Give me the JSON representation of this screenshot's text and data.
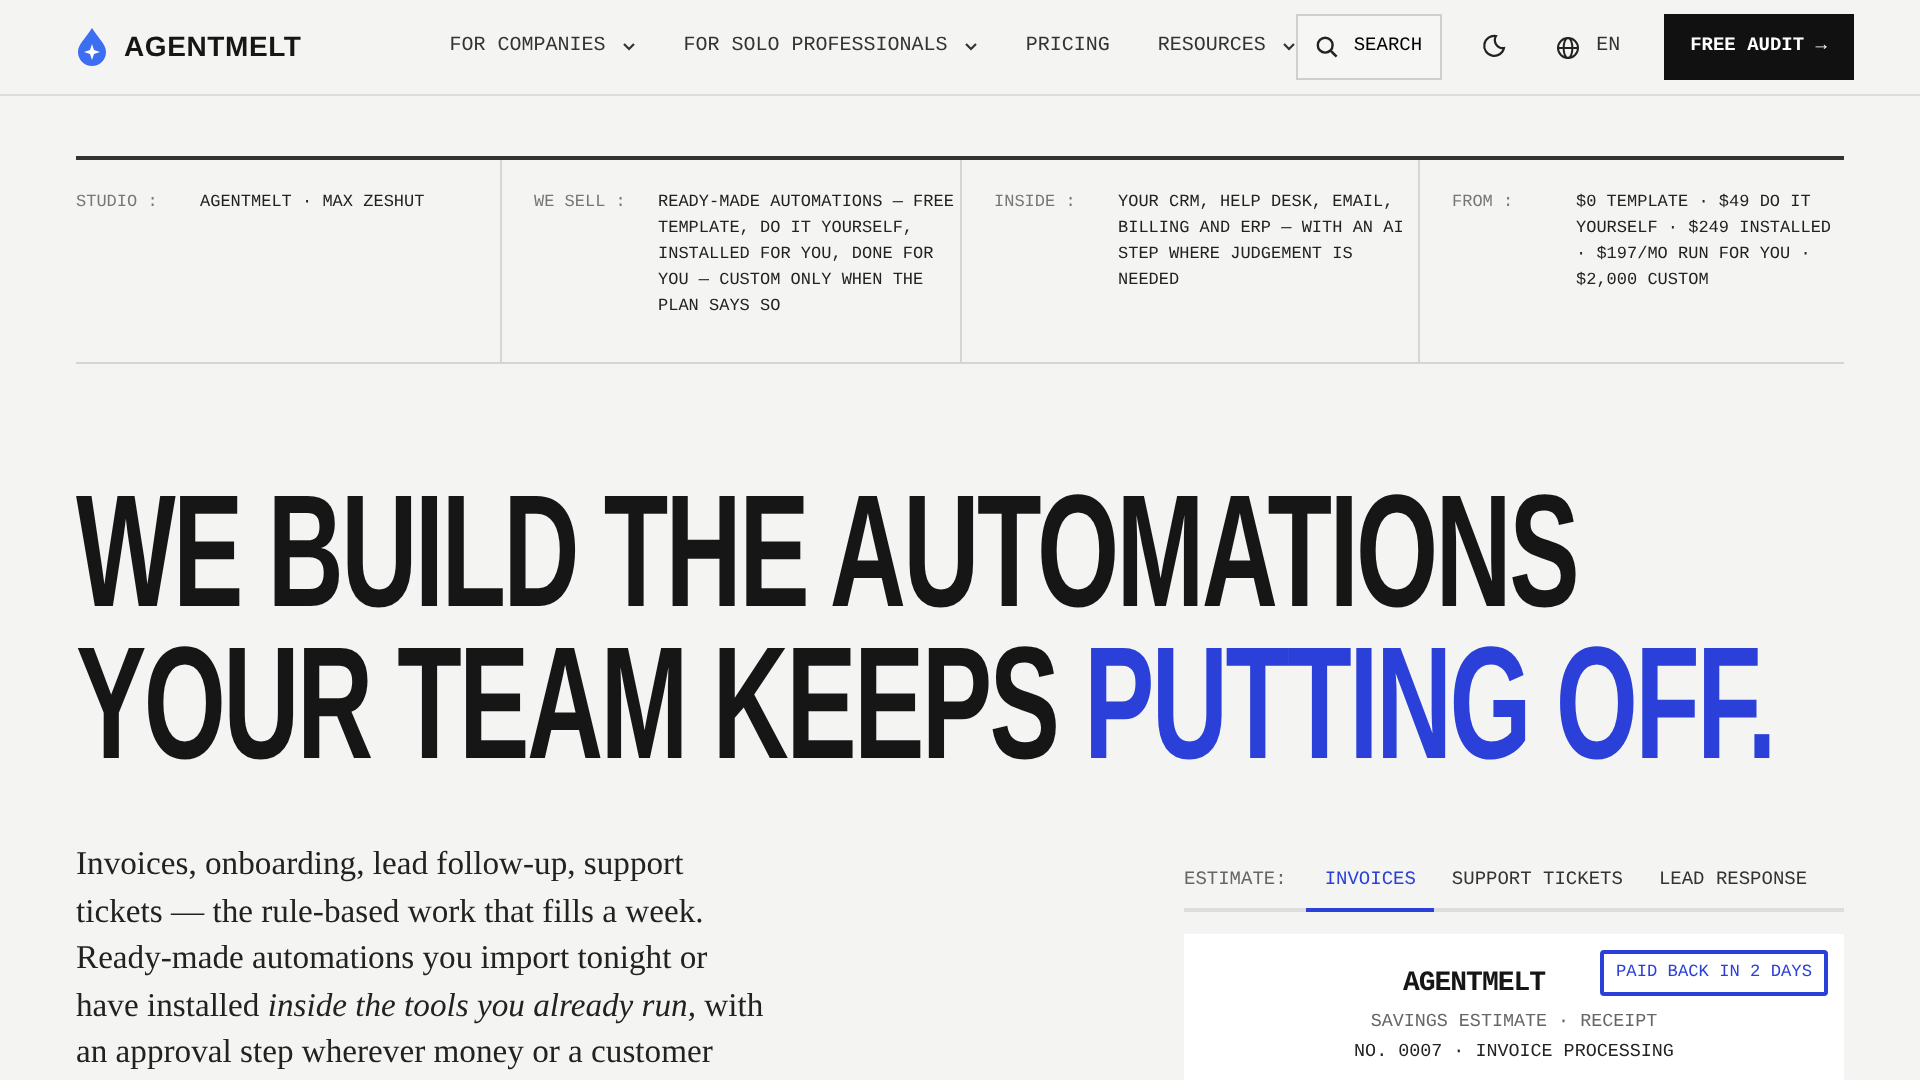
{
  "nav": {
    "brand": "AGENTMELT",
    "links": [
      {
        "label": "FOR COMPANIES",
        "dropdown": true
      },
      {
        "label": "FOR SOLO PROFESSIONALS",
        "dropdown": true
      },
      {
        "label": "PRICING",
        "dropdown": false
      },
      {
        "label": "RESOURCES",
        "dropdown": true
      }
    ],
    "search": "SEARCH",
    "language": "EN",
    "cta": "FREE AUDIT →"
  },
  "facts": [
    {
      "label": "STUDIO :",
      "value": "AGENTMELT · MAX ZESHUT"
    },
    {
      "label": "WE SELL :",
      "value": "READY-MADE AUTOMATIONS — FREE TEMPLATE, DO IT YOURSELF, INSTALLED FOR YOU, DONE FOR YOU — CUSTOM ONLY WHEN THE PLAN SAYS SO"
    },
    {
      "label": "INSIDE :",
      "value": "YOUR CRM, HELP DESK, EMAIL, BILLING AND ERP — WITH AN AI STEP WHERE JUDGEMENT IS NEEDED"
    },
    {
      "label": "FROM :",
      "value": "$0 TEMPLATE · $49 DO IT YOURSELF · $249 INSTALLED · $197/MO RUN FOR YOU · $2,000 CUSTOM"
    }
  ],
  "headline": {
    "line_1": "WE BUILD THE AUTOMATIONS",
    "line_2": "YOUR TEAM KEEPS",
    "line_2_accent": "PUTTING OFF."
  },
  "intro": "Invoices, onboarding, lead follow-up, support tickets — the rule-based work that fills a week. Ready-made automations you import tonight or have installed *inside the tools you already run,* with an approval step wherever money or a customer",
  "estimate": {
    "label": "ESTIMATE:",
    "tabs": [
      {
        "label": "INVOICES",
        "selected": true
      },
      {
        "label": "SUPPORT TICKETS",
        "selected": false
      },
      {
        "label": "LEAD RESPONSE",
        "selected": false
      }
    ],
    "receipt": {
      "brand": "AGENTMELT",
      "badge": "PAID BACK IN 2 DAYS",
      "subtitle": "SAVINGS ESTIMATE · RECEIPT",
      "number": "NO. 0007 · INVOICE PROCESSING"
    }
  }
}
